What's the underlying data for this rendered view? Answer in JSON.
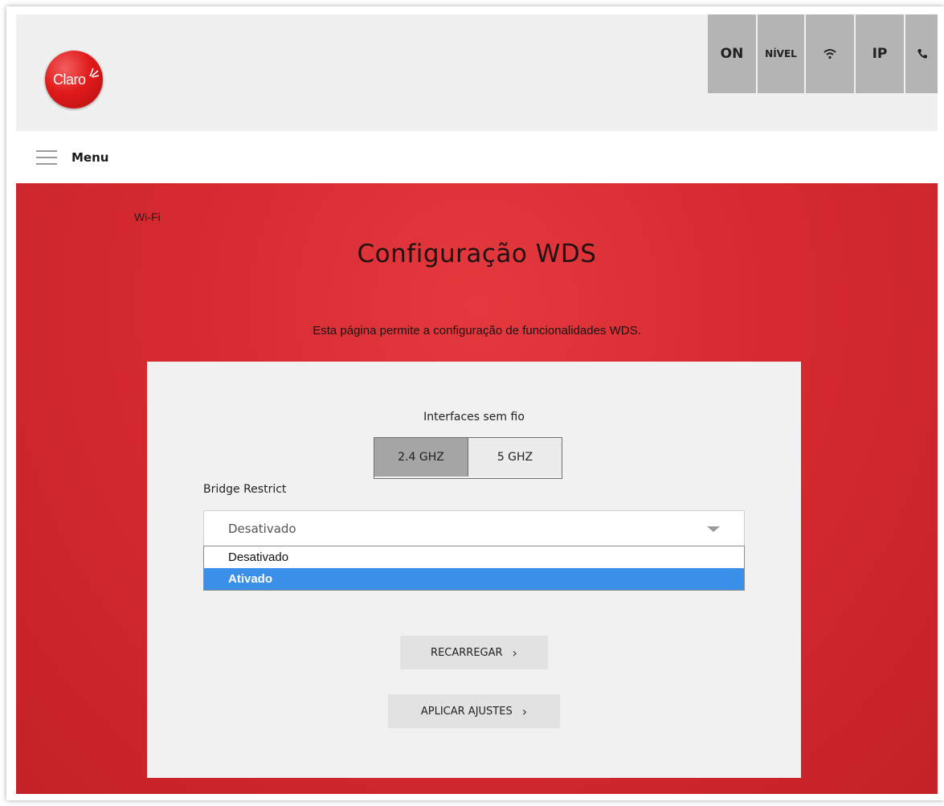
{
  "header": {
    "logo_text": "Claro",
    "status_tiles": {
      "on": "ON",
      "nivel": "NÍVEL",
      "wifi_icon": "wifi-icon",
      "ip": "IP",
      "phone_icon": "phone-icon"
    }
  },
  "menu": {
    "label": "Menu",
    "icon": "hamburger-icon"
  },
  "breadcrumb": "Wi-Fi",
  "page": {
    "title": "Configuração WDS",
    "description": "Esta página permite a configuração de funcionalidades WDS."
  },
  "form": {
    "interfaces_label": "Interfaces sem fio",
    "bands": {
      "band_24": "2.4 GHZ",
      "band_5": "5 GHZ",
      "active": "2.4 GHZ"
    },
    "bridge_restrict_label": "Bridge Restrict",
    "bridge_restrict_value": "Desativado",
    "options": [
      "Desativado",
      "Ativado"
    ],
    "highlighted_option": "Ativado"
  },
  "buttons": {
    "reload": "RECARREGAR",
    "apply": "APLICAR AJUSTES"
  },
  "colors": {
    "brand_red": "#d52a30",
    "highlight_blue": "#3a8fe8",
    "tile_gray": "#b4b4b4"
  }
}
